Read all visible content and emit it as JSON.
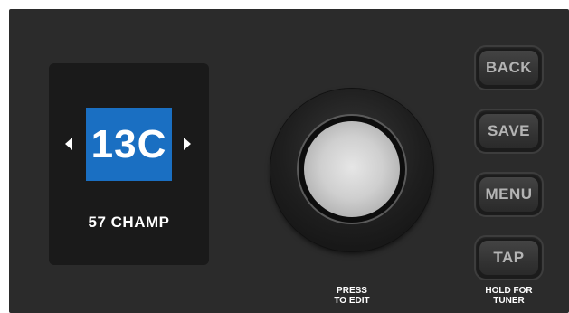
{
  "display": {
    "preset_number": "13C",
    "preset_name": "57 CHAMP",
    "accent_color": "#1a6fc2"
  },
  "knob": {
    "label_line1": "PRESS",
    "label_line2": "TO EDIT"
  },
  "buttons": {
    "back": "BACK",
    "save": "SAVE",
    "menu": "MENU",
    "tap": "TAP",
    "tap_label_line1": "HOLD FOR",
    "tap_label_line2": "TUNER"
  }
}
